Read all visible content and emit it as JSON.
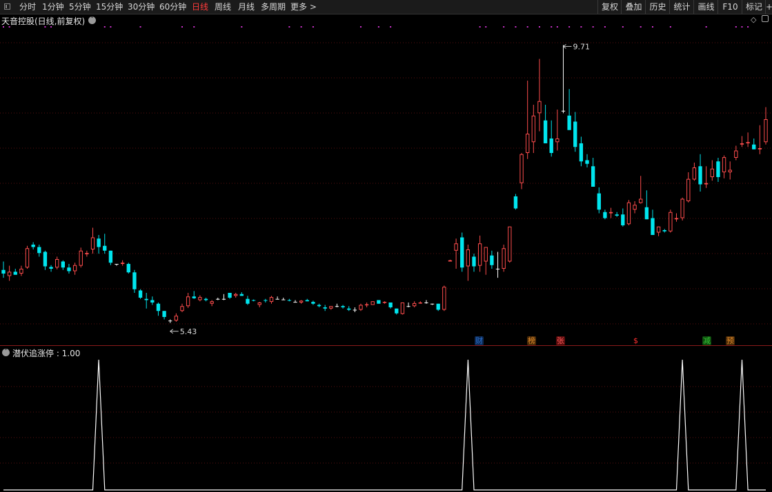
{
  "toolbar": {
    "periods": [
      "分时",
      "1分钟",
      "5分钟",
      "15分钟",
      "30分钟",
      "60分钟",
      "日线",
      "周线",
      "月线",
      "多周期",
      "更多 >"
    ],
    "active_period": "日线",
    "right_buttons": [
      "复权",
      "叠加",
      "历史",
      "统计",
      "画线",
      "F10",
      "标记",
      "+"
    ]
  },
  "stock_title": "天音控股(日线,前复权)",
  "indicator_title": "潜伏追涨停 : 1.00",
  "events": [
    {
      "label": "财",
      "color": "#2a6cc6",
      "bg": "#0d2a55"
    },
    {
      "label": "榜",
      "color": "#e08b2a",
      "bg": "#4a2a08"
    },
    {
      "label": "张",
      "color": "#ff5a5a",
      "bg": "#5a0d0d"
    },
    {
      "label": "$",
      "color": "#ff3030",
      "bg": "#000000"
    },
    {
      "label": "减",
      "color": "#38c638",
      "bg": "#0d4a0d"
    },
    {
      "label": "预",
      "color": "#e08b2a",
      "bg": "#4a2a08"
    }
  ],
  "colors": {
    "up": "#ff4d4d",
    "down": "#00e5ee",
    "flat": "#ffffff",
    "grid": "#5a1010",
    "signal": "#ffffff",
    "dots": "#cc33cc"
  },
  "chart_data": {
    "type": "candlestick",
    "ohlc": [
      [
        5.98,
        6.12,
        5.85,
        5.92
      ],
      [
        5.88,
        6.05,
        5.8,
        5.95
      ],
      [
        5.95,
        6.0,
        5.9,
        5.9
      ],
      [
        5.92,
        6.05,
        5.88,
        6.0
      ],
      [
        6.02,
        6.38,
        6.0,
        6.34
      ],
      [
        6.4,
        6.44,
        6.32,
        6.36
      ],
      [
        6.36,
        6.4,
        6.2,
        6.26
      ],
      [
        6.28,
        6.3,
        5.98,
        6.04
      ],
      [
        6.03,
        6.06,
        5.95,
        6.0
      ],
      [
        6.02,
        6.2,
        5.99,
        6.16
      ],
      [
        6.12,
        6.14,
        5.98,
        6.02
      ],
      [
        6.02,
        6.08,
        5.92,
        5.96
      ],
      [
        5.96,
        6.1,
        5.9,
        6.06
      ],
      [
        6.05,
        6.35,
        6.02,
        6.3
      ],
      [
        6.24,
        6.3,
        6.2,
        6.26
      ],
      [
        6.32,
        6.68,
        6.25,
        6.52
      ],
      [
        6.5,
        6.56,
        6.25,
        6.36
      ],
      [
        6.38,
        6.58,
        6.25,
        6.3
      ],
      [
        6.3,
        6.3,
        6.06,
        6.1
      ],
      [
        6.08,
        6.08,
        6.05,
        6.08
      ],
      [
        6.08,
        6.14,
        6.05,
        6.1
      ],
      [
        6.08,
        6.1,
        5.92,
        5.94
      ],
      [
        5.94,
        5.98,
        5.6,
        5.66
      ],
      [
        5.64,
        5.66,
        5.5,
        5.52
      ],
      [
        5.5,
        5.6,
        5.34,
        5.48
      ],
      [
        5.48,
        5.54,
        5.4,
        5.44
      ],
      [
        5.42,
        5.44,
        5.22,
        5.3
      ],
      [
        5.3,
        5.3,
        5.16,
        5.2
      ],
      [
        5.14,
        5.16,
        5.1,
        5.14
      ],
      [
        5.14,
        5.26,
        5.12,
        5.22
      ],
      [
        5.3,
        5.42,
        5.28,
        5.38
      ],
      [
        5.38,
        5.6,
        5.35,
        5.54
      ],
      [
        5.54,
        5.63,
        5.5,
        5.51
      ],
      [
        5.48,
        5.56,
        5.46,
        5.53
      ],
      [
        5.5,
        5.52,
        5.46,
        5.48
      ],
      [
        5.42,
        5.48,
        5.38,
        5.46
      ],
      [
        5.5,
        5.52,
        5.48,
        5.5
      ],
      [
        5.5,
        5.58,
        5.48,
        5.5
      ],
      [
        5.6,
        5.6,
        5.5,
        5.52
      ],
      [
        5.55,
        5.6,
        5.52,
        5.58
      ],
      [
        5.58,
        5.61,
        5.55,
        5.55
      ],
      [
        5.5,
        5.55,
        5.4,
        5.42
      ],
      [
        5.48,
        5.49,
        5.46,
        5.47
      ],
      [
        5.4,
        5.45,
        5.36,
        5.44
      ],
      [
        5.48,
        5.5,
        5.44,
        5.47
      ],
      [
        5.45,
        5.55,
        5.42,
        5.53
      ],
      [
        5.5,
        5.54,
        5.49,
        5.5
      ],
      [
        5.49,
        5.52,
        5.48,
        5.49
      ],
      [
        5.48,
        5.5,
        5.46,
        5.47
      ],
      [
        5.45,
        5.48,
        5.44,
        5.45
      ],
      [
        5.44,
        5.48,
        5.42,
        5.47
      ],
      [
        5.48,
        5.5,
        5.46,
        5.46
      ],
      [
        5.45,
        5.47,
        5.4,
        5.42
      ],
      [
        5.4,
        5.42,
        5.36,
        5.38
      ],
      [
        5.36,
        5.4,
        5.3,
        5.34
      ],
      [
        5.34,
        5.38,
        5.32,
        5.38
      ],
      [
        5.38,
        5.42,
        5.36,
        5.38
      ],
      [
        5.38,
        5.4,
        5.34,
        5.36
      ],
      [
        5.34,
        5.38,
        5.3,
        5.32
      ],
      [
        5.32,
        5.36,
        5.28,
        5.32
      ],
      [
        5.32,
        5.42,
        5.3,
        5.4
      ],
      [
        5.4,
        5.44,
        5.36,
        5.41
      ],
      [
        5.4,
        5.46,
        5.4,
        5.46
      ],
      [
        5.48,
        5.48,
        5.42,
        5.42
      ],
      [
        5.44,
        5.46,
        5.42,
        5.45
      ],
      [
        5.44,
        5.44,
        5.34,
        5.36
      ],
      [
        5.34,
        5.34,
        5.24,
        5.26
      ],
      [
        5.25,
        5.44,
        5.24,
        5.44
      ],
      [
        5.38,
        5.44,
        5.36,
        5.38
      ],
      [
        5.38,
        5.46,
        5.36,
        5.43
      ],
      [
        5.43,
        5.46,
        5.42,
        5.44
      ],
      [
        5.44,
        5.48,
        5.42,
        5.44
      ],
      [
        5.42,
        5.42,
        5.4,
        5.42
      ],
      [
        5.42,
        5.42,
        5.3,
        5.32
      ],
      [
        5.32,
        5.72,
        5.3,
        5.7
      ],
      [
        6.12,
        6.15,
        6.12,
        6.14
      ],
      [
        6.3,
        6.5,
        6.0,
        6.42
      ],
      [
        6.52,
        6.6,
        5.95,
        6.02
      ],
      [
        6.04,
        6.4,
        5.8,
        6.32
      ],
      [
        6.2,
        6.25,
        5.95,
        6.04
      ],
      [
        6.05,
        6.55,
        5.95,
        6.42
      ],
      [
        6.12,
        6.35,
        5.9,
        6.36
      ],
      [
        6.22,
        6.3,
        6.0,
        6.06
      ],
      [
        6.0,
        6.28,
        5.85,
        6.0
      ],
      [
        6.0,
        6.4,
        5.95,
        6.34
      ],
      [
        6.12,
        6.58,
        6.1,
        6.7
      ],
      [
        7.2,
        7.24,
        6.98,
        7.0
      ],
      [
        7.42,
        7.92,
        7.32,
        7.9
      ],
      [
        7.92,
        9.12,
        7.82,
        8.24
      ],
      [
        8.1,
        8.72,
        7.92,
        8.54
      ],
      [
        8.58,
        9.48,
        8.28,
        8.78
      ],
      [
        8.46,
        8.72,
        8.1,
        8.08
      ],
      [
        8.16,
        8.46,
        7.86,
        7.92
      ],
      [
        8.1,
        8.64,
        7.96,
        8.16
      ],
      [
        8.62,
        9.71,
        8.58,
        8.62
      ],
      [
        8.54,
        8.98,
        8.4,
        8.3
      ],
      [
        8.44,
        8.6,
        7.94,
        8.02
      ],
      [
        8.08,
        8.19,
        7.7,
        7.78
      ],
      [
        7.8,
        7.9,
        7.68,
        7.74
      ],
      [
        7.7,
        7.84,
        7.42,
        7.36
      ],
      [
        7.25,
        7.35,
        6.92,
        6.98
      ],
      [
        6.94,
        6.98,
        6.82,
        6.84
      ],
      [
        6.92,
        7.01,
        6.84,
        6.94
      ],
      [
        6.9,
        6.94,
        6.86,
        6.88
      ],
      [
        6.9,
        7.0,
        6.7,
        6.72
      ],
      [
        6.74,
        7.14,
        6.72,
        7.1
      ],
      [
        6.98,
        7.12,
        6.92,
        7.06
      ],
      [
        7.09,
        7.54,
        7.08,
        7.16
      ],
      [
        7.02,
        7.3,
        6.82,
        6.82
      ],
      [
        6.84,
        6.98,
        6.56,
        6.56
      ],
      [
        6.6,
        6.7,
        6.54,
        6.7
      ],
      [
        6.64,
        6.66,
        6.6,
        6.62
      ],
      [
        6.62,
        6.98,
        6.6,
        6.94
      ],
      [
        6.82,
        6.92,
        6.78,
        6.84
      ],
      [
        6.84,
        7.18,
        6.8,
        7.16
      ],
      [
        7.12,
        7.6,
        7.1,
        7.49
      ],
      [
        7.48,
        7.76,
        7.46,
        7.68
      ],
      [
        7.7,
        7.9,
        7.28,
        7.4
      ],
      [
        7.4,
        7.7,
        7.34,
        7.42
      ],
      [
        7.52,
        7.8,
        7.46,
        7.66
      ],
      [
        7.78,
        7.84,
        7.44,
        7.52
      ],
      [
        7.6,
        7.88,
        7.5,
        7.85
      ],
      [
        7.6,
        7.78,
        7.48,
        7.64
      ],
      [
        7.84,
        8.04,
        7.8,
        7.96
      ],
      [
        8.06,
        8.2,
        8.02,
        8.08
      ],
      [
        8.08,
        8.26,
        8.02,
        8.1
      ],
      [
        8.06,
        8.16,
        7.98,
        7.98
      ],
      [
        7.98,
        8.38,
        7.9,
        8.0
      ],
      [
        8.1,
        8.68,
        8.06,
        8.48
      ]
    ],
    "ylim": [
      4.8,
      10.0
    ],
    "high_label": "9.71",
    "low_label": "5.43",
    "signal": {
      "name": "潜伏追涨停",
      "value": 1.0,
      "spikes_at": [
        16,
        78,
        114,
        124
      ]
    }
  }
}
